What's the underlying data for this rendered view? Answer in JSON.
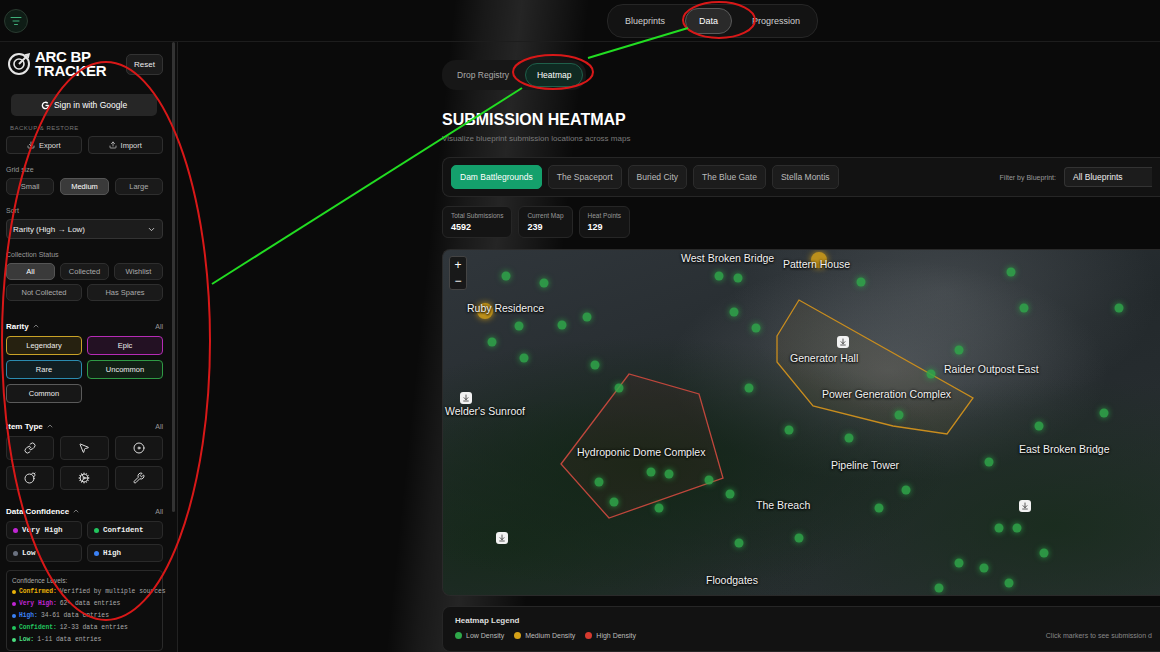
{
  "nav_tabs": [
    {
      "label": "Blueprints",
      "selected": false
    },
    {
      "label": "Data",
      "selected": true
    },
    {
      "label": "Progression",
      "selected": false
    }
  ],
  "sidebar": {
    "logo": [
      "ARC BP",
      "TRACKER"
    ],
    "reset": "Reset",
    "sign_in": "Sign in with Google",
    "backup_label": "BACKUP & RESTORE",
    "backup_buttons": [
      "Export",
      "Import"
    ],
    "grid_size": {
      "label": "Grid size",
      "options": [
        {
          "label": "Small",
          "selected": false
        },
        {
          "label": "Medium",
          "selected": true
        },
        {
          "label": "Large",
          "selected": false
        }
      ]
    },
    "sort": {
      "label": "Sort",
      "value": "Rarity (High → Low)"
    },
    "collection_status": {
      "label": "Collection Status",
      "options": [
        {
          "label": "All",
          "selected": true
        },
        {
          "label": "Collected",
          "selected": false
        },
        {
          "label": "Wishlist",
          "selected": false
        },
        {
          "label": "Not Collected",
          "selected": false
        },
        {
          "label": "Has Spares",
          "selected": false
        }
      ]
    },
    "rarity": {
      "label": "Rarity",
      "all": "All",
      "expanded": true,
      "options": [
        {
          "label": "Legendary",
          "color": "#c9a227"
        },
        {
          "label": "Epic",
          "color": "#b52bb5"
        },
        {
          "label": "Rare",
          "color": "#2b8bb0"
        },
        {
          "label": "Uncommon",
          "color": "#2f9a45"
        },
        {
          "label": "Common",
          "color": "#5a5a5a"
        }
      ]
    },
    "item_type": {
      "label": "Item Type",
      "all": "All",
      "expanded": true
    },
    "data_confidence": {
      "label": "Data Confidence",
      "all": "All",
      "expanded": true,
      "options": [
        {
          "label": "Very High",
          "color": "#c026d3"
        },
        {
          "label": "Confident",
          "color": "#22c55e"
        },
        {
          "label": "Low",
          "color": "#6b7280"
        },
        {
          "label": "High",
          "color": "#3b82f6"
        }
      ]
    },
    "confidence_levels": {
      "title": "Confidence Levels:",
      "items": [
        {
          "label": "Confirmed:",
          "text": "Verified by multiple sources",
          "color": "#eab308"
        },
        {
          "label": "Very High:",
          "text": "62+ data entries",
          "color": "#c026d3"
        },
        {
          "label": "High:",
          "text": "34-61 data entries",
          "color": "#3b82f6"
        },
        {
          "label": "Confident:",
          "text": "12-33 data entries",
          "color": "#22c55e"
        },
        {
          "label": "Low:",
          "text": "1-11 data entries",
          "color": "#4ade80"
        }
      ]
    }
  },
  "sub_tabs": [
    {
      "label": "Drop Registry",
      "selected": false
    },
    {
      "label": "Heatmap",
      "selected": true
    }
  ],
  "page": {
    "title": "SUBMISSION HEATMAP",
    "subtitle": "Visualize blueprint submission locations across maps"
  },
  "map_tabs": [
    {
      "label": "Dam Battlegrounds",
      "selected": true
    },
    {
      "label": "The Spaceport",
      "selected": false
    },
    {
      "label": "Buried City",
      "selected": false
    },
    {
      "label": "The Blue Gate",
      "selected": false
    },
    {
      "label": "Stella Montis",
      "selected": false
    }
  ],
  "filter": {
    "label": "Filter by Blueprint:",
    "value": "All Blueprints"
  },
  "stats": [
    {
      "label": "Total Submissions",
      "value": "4592"
    },
    {
      "label": "Current Map",
      "value": "239"
    },
    {
      "label": "Heat Points",
      "value": "129"
    }
  ],
  "map": {
    "zoom": [
      "+",
      "−"
    ],
    "labels": [
      "West Broken Bridge",
      "Pattern House",
      "Ruby Residence",
      "Generator Hall",
      "Raider Outpost East",
      "Power Generation Complex",
      "Welder's Sunroof",
      "Hydroponic Dome Complex",
      "East Broken Bridge",
      "Pipeline Tower",
      "The Breach",
      "Floodgates"
    ],
    "heat_points": [
      {
        "density": "low"
      },
      {
        "density": "low"
      },
      {
        "density": "low"
      },
      {
        "density": "low"
      },
      {
        "density": "low"
      },
      {
        "density": "low"
      },
      {
        "density": "low"
      },
      {
        "density": "low"
      },
      {
        "density": "low"
      },
      {
        "density": "low"
      },
      {
        "density": "low"
      },
      {
        "density": "low"
      },
      {
        "density": "medium"
      },
      {
        "density": "medium"
      },
      {
        "density": "low"
      },
      {
        "density": "low"
      },
      {
        "density": "low"
      },
      {
        "density": "low"
      },
      {
        "density": "low"
      },
      {
        "density": "low"
      },
      {
        "density": "low"
      },
      {
        "density": "low"
      },
      {
        "density": "low"
      },
      {
        "density": "low"
      },
      {
        "density": "low"
      },
      {
        "density": "low"
      },
      {
        "density": "low"
      },
      {
        "density": "low"
      },
      {
        "density": "low"
      },
      {
        "density": "low"
      },
      {
        "density": "low"
      },
      {
        "density": "low"
      },
      {
        "density": "low"
      },
      {
        "density": "low"
      },
      {
        "density": "low"
      },
      {
        "density": "low"
      },
      {
        "density": "low"
      },
      {
        "density": "low"
      },
      {
        "density": "low"
      },
      {
        "density": "low"
      },
      {
        "density": "low"
      },
      {
        "density": "low"
      },
      {
        "density": "low"
      },
      {
        "density": "low"
      },
      {
        "density": "low"
      },
      {
        "density": "low"
      }
    ]
  },
  "legend": {
    "title": "Heatmap Legend",
    "items": [
      {
        "label": "Low Density",
        "density": "low",
        "color": "#2fa84a"
      },
      {
        "label": "Medium Density",
        "density": "medium",
        "color": "#d4a017"
      },
      {
        "label": "High Density",
        "density": "high",
        "color": "#d63a2f"
      }
    ],
    "hint": "Click markers to see submission d"
  }
}
